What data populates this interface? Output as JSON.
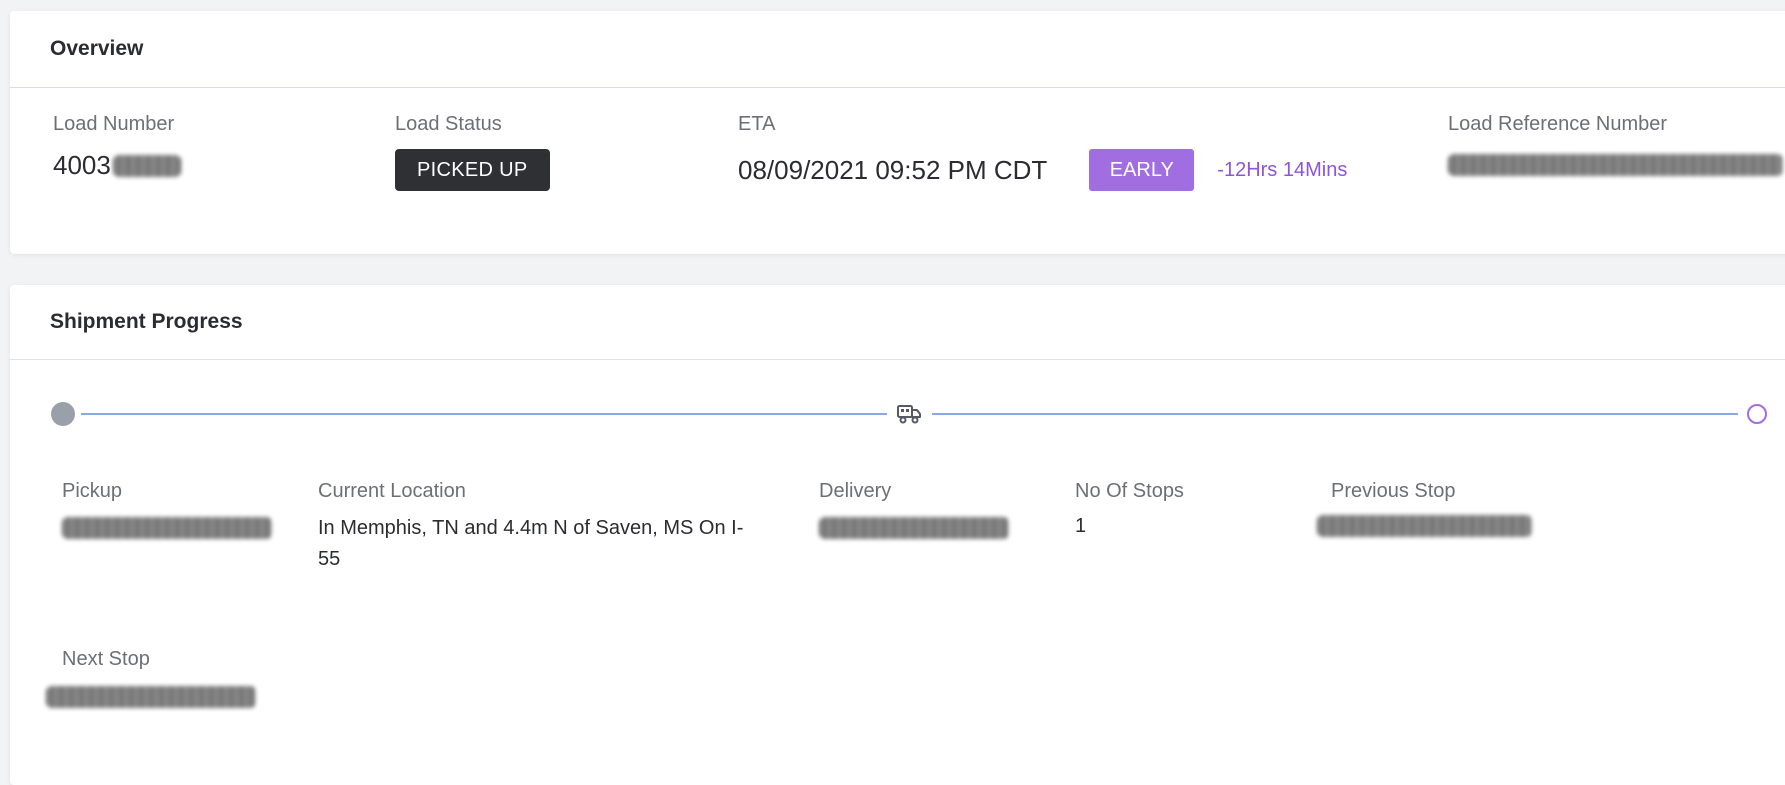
{
  "overview": {
    "title": "Overview",
    "load_number_label": "Load Number",
    "load_number_prefix": "4003",
    "load_status_label": "Load Status",
    "load_status": "PICKED UP",
    "eta_label": "ETA",
    "eta_value": "08/09/2021 09:52 PM CDT",
    "eta_badge": "EARLY",
    "eta_delta": "-12Hrs 14Mins",
    "load_reference_label": "Load Reference Number"
  },
  "progress": {
    "title": "Shipment Progress",
    "truck_icon": "truck-icon",
    "pickup_label": "Pickup",
    "current_location_label": "Current Location",
    "current_location_value": "In Memphis, TN and 4.4m N of Saven, MS On I-55",
    "delivery_label": "Delivery",
    "stops_label": "No Of Stops",
    "stops_value": "1",
    "previous_stop_label": "Previous Stop",
    "next_stop_label": "Next Stop"
  },
  "colors": {
    "accent": "#a06ee0",
    "status_dark": "#2f3033",
    "track_line": "#8aa8e6"
  }
}
